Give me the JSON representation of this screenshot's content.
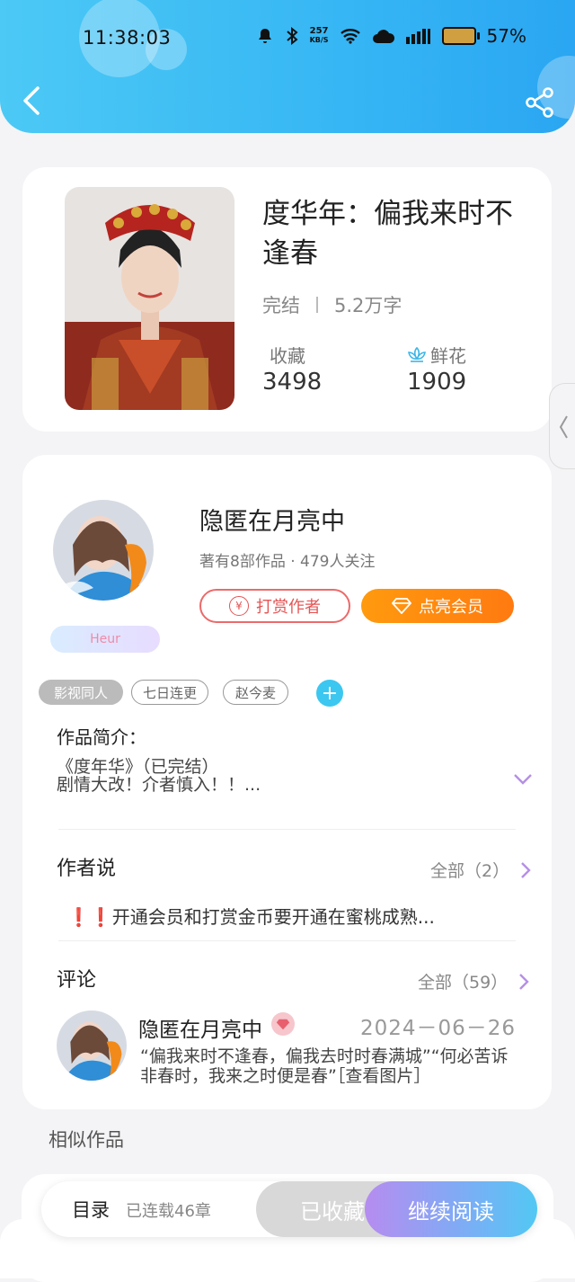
{
  "status_bar": {
    "time": "11:38:03",
    "net_speed_top": "257",
    "net_speed_unit": "KB/S",
    "battery": "57%"
  },
  "header": {
    "accent_color": "#36b6f4"
  },
  "book": {
    "title": "度华年：偏我来时不逢春",
    "status": "完结",
    "word_count": "5.2万字",
    "collect_label": "收藏",
    "collect_count": "3498",
    "flower_label": "鲜花",
    "flower_count": "1909"
  },
  "author": {
    "name": "隐匿在月亮中",
    "summary": "著有8部作品 · 479人关注",
    "tip_button": "打赏作者",
    "tip_coin": "¥",
    "vip_button": "点亮会员",
    "nameplate": "Heur"
  },
  "tags": [
    "影视同人",
    "七日连更",
    "赵今麦"
  ],
  "tag_add": "+",
  "intro": {
    "title": "作品简介：",
    "line1": "《度年华》（已完结）",
    "line2": "剧情大改！介者慎入！！..."
  },
  "author_says": {
    "title": "作者说",
    "all_link": "全部（2）",
    "content": "❗❗开通会员和打赏金币要开通在蜜桃成熟..."
  },
  "comments": {
    "title": "评论",
    "all_link": "全部（59）",
    "first": {
      "name": "隐匿在月亮中",
      "date": "2024－06－26",
      "text": "“偏我来时不逢春，偏我去时时春满城”“何必苦诉非春时，我来之时便是春”［查看图片］"
    }
  },
  "similar_title": "相似作品",
  "bottom_bar": {
    "toc": "目录",
    "chapters": "已连载46章",
    "collected": "已收藏",
    "continue": "继续阅读"
  }
}
